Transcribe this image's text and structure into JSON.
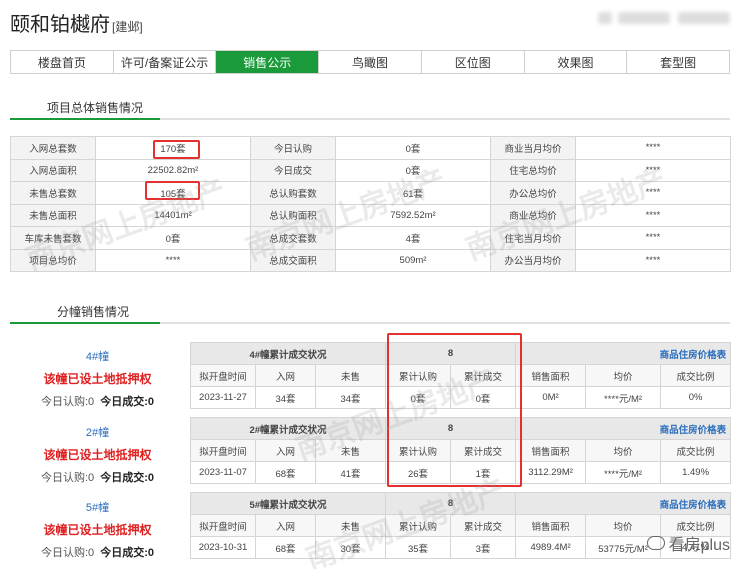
{
  "header": {
    "title": "颐和铂樾府",
    "city": "[建邺]"
  },
  "tabs": [
    {
      "label": "楼盘首页",
      "active": false
    },
    {
      "label": "许可/备案证公示",
      "active": false
    },
    {
      "label": "销售公示",
      "active": true
    },
    {
      "label": "鸟瞰图",
      "active": false
    },
    {
      "label": "区位图",
      "active": false
    },
    {
      "label": "效果图",
      "active": false
    },
    {
      "label": "套型图",
      "active": false
    }
  ],
  "overall": {
    "section_title": "项目总体销售情况",
    "rows": [
      [
        "入网总套数",
        "170套",
        "今日认购",
        "0套",
        "商业当月均价",
        "****"
      ],
      [
        "入网总面积",
        "22502.82m²",
        "今日成交",
        "0套",
        "住宅总均价",
        "****"
      ],
      [
        "未售总套数",
        "105套",
        "总认购套数",
        "61套",
        "办公总均价",
        "****"
      ],
      [
        "未售总面积",
        "14401m²",
        "总认购面积",
        "7592.52m²",
        "商业总均价",
        "****"
      ],
      [
        "车库未售套数",
        "0套",
        "总成交套数",
        "4套",
        "住宅当月均价",
        "****"
      ],
      [
        "项目总均价",
        "****",
        "总成交面积",
        "509m²",
        "办公当月均价",
        "****"
      ]
    ]
  },
  "buildings_section_title": "分幢销售情况",
  "buildings": [
    {
      "name": "4#幢",
      "warning": "该幢已设土地抵押权",
      "today_sub": "今日认购:0",
      "today_deal": "今日成交:0",
      "stat_title": "4#幢累计成交状况",
      "stat_count": "8",
      "price_link": "商品住房价格表",
      "cols": [
        "拟开盘时间",
        "入网",
        "未售",
        "累计认购",
        "累计成交",
        "销售面积",
        "均价",
        "成交比例"
      ],
      "values": [
        "2023-11-27",
        "34套",
        "34套",
        "0套",
        "0套",
        "0M²",
        "****元/M²",
        "0%"
      ]
    },
    {
      "name": "2#幢",
      "warning": "该幢已设土地抵押权",
      "today_sub": "今日认购:0",
      "today_deal": "今日成交:0",
      "stat_title": "2#幢累计成交状况",
      "stat_count": "8",
      "price_link": "商品住房价格表",
      "cols": [
        "拟开盘时间",
        "入网",
        "未售",
        "累计认购",
        "累计成交",
        "销售面积",
        "均价",
        "成交比例"
      ],
      "values": [
        "2023-11-07",
        "68套",
        "41套",
        "26套",
        "1套",
        "3112.29M²",
        "****元/M²",
        "1.49%"
      ]
    },
    {
      "name": "5#幢",
      "warning": "该幢已设土地抵押权",
      "today_sub": "今日认购:0",
      "today_deal": "今日成交:0",
      "stat_title": "5#幢累计成交状况",
      "stat_count": "8",
      "price_link": "商品住房价格表",
      "cols": [
        "拟开盘时间",
        "入网",
        "未售",
        "累计认购",
        "累计成交",
        "销售面积",
        "均价",
        "成交比例"
      ],
      "values": [
        "2023-10-31",
        "68套",
        "30套",
        "35套",
        "3套",
        "4989.4M²",
        "53775元/M²",
        "4.41%"
      ]
    }
  ],
  "watermark": "南京网上房地产",
  "brand": "看房plus"
}
